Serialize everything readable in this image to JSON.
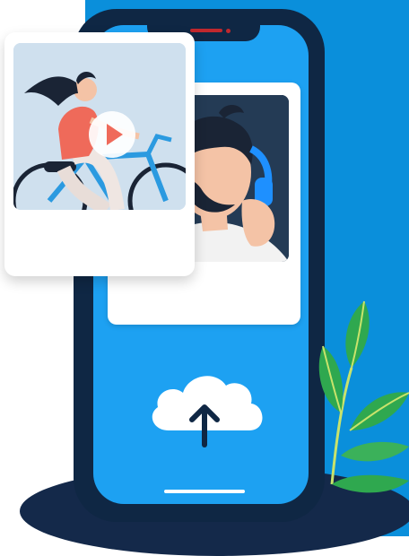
{
  "scene": {
    "colors": {
      "background_panel": "#0a8fdb",
      "phone_body": "#0f2744",
      "phone_screen": "#1da1f2",
      "card": "#ffffff",
      "leaf": "#2fa84f",
      "notch_accent": "#c0282d"
    },
    "icons": {
      "play": "play-icon",
      "upload": "cloud-upload-icon",
      "arrow": "arrow-up-icon"
    }
  }
}
